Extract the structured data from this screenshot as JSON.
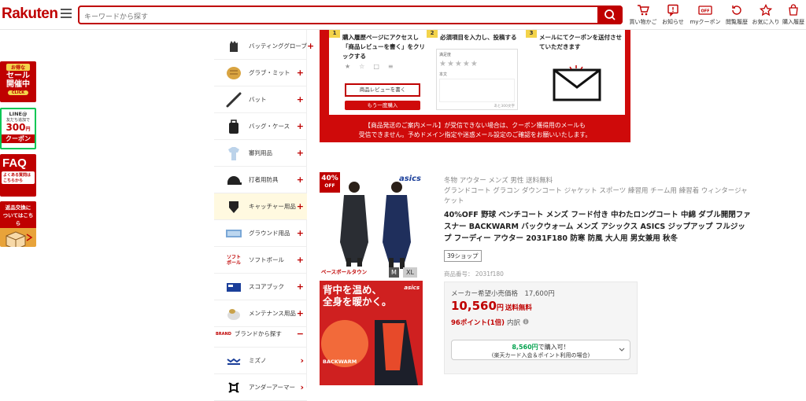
{
  "header": {
    "logo": "Rakuten",
    "search_placeholder": "キーワードから探す",
    "icons": [
      {
        "label": "買い物かご",
        "icon": "cart-icon"
      },
      {
        "label": "お知らせ",
        "icon": "notice-icon"
      },
      {
        "label": "myクーポン",
        "icon": "coupon-icon"
      },
      {
        "label": "閲覧履歴",
        "icon": "history-icon"
      },
      {
        "label": "お気に入り",
        "icon": "star-icon"
      },
      {
        "label": "購入履歴",
        "icon": "purchase-history-icon"
      }
    ]
  },
  "left_banners": {
    "sale": {
      "top": "お得な",
      "main1": "セール",
      "main2": "開催中",
      "cta": "CLICK"
    },
    "line": {
      "top": "LINE@",
      "sub": "友だち追加で",
      "amount": "300",
      "unit": "円",
      "main": "クーポン"
    },
    "faq": {
      "main": "FAQ",
      "sub": "よくある質問は",
      "sub2": "こちらから"
    },
    "exchange": {
      "l1": "返品交換に",
      "l2": "ついてはこちら"
    }
  },
  "sidebar": {
    "items": [
      {
        "label": "バッティンググローブ",
        "expand": "+"
      },
      {
        "label": "グラブ・ミット",
        "expand": "+"
      },
      {
        "label": "バット",
        "expand": "+"
      },
      {
        "label": "バッグ・ケース",
        "expand": "+"
      },
      {
        "label": "審判用品",
        "expand": "+"
      },
      {
        "label": "打者用防具",
        "expand": "+"
      },
      {
        "label": "キャッチャー用品",
        "expand": "+"
      },
      {
        "label": "グラウンド用品",
        "expand": "+"
      },
      {
        "label": "ソフトボール",
        "expand": "+"
      },
      {
        "label": "スコアブック",
        "expand": "+"
      },
      {
        "label": "メンテナンス用品",
        "expand": "+"
      },
      {
        "label": "ブランドから探す",
        "expand": "−"
      },
      {
        "label": "ミズノ",
        "expand": "›"
      },
      {
        "label": "アンダーアーマー",
        "expand": "›"
      }
    ],
    "brand_prefix": "BRAND",
    "softball_logo": "ソフト ボール"
  },
  "promo": {
    "step1": {
      "num": "1",
      "title": "購入履歴ページにアクセスし「商品レビューを書く」をクリックする",
      "button": "商品レビューを書く",
      "button2": "もう一度購入",
      "mini_labels": [
        "★",
        "☆",
        "□",
        "≡"
      ]
    },
    "step2": {
      "num": "2",
      "title": "必須項目を入力し、投稿する",
      "field1": "満足度",
      "field2": "本文",
      "required": "必須",
      "counter": "あと300文字"
    },
    "step3": {
      "num": "3",
      "title": "メールにてクーポンを送付させていただきます"
    },
    "footer_line1": "【商品発送のご案内メール】が受信できない場合は、クーポン獲得用のメールも",
    "footer_line2": "受信できません。予めドメイン指定や迷惑メール設定のご確認をお願いいたします。"
  },
  "product": {
    "discount_badge": "40%",
    "discount_badge_sub": "OFF",
    "brand_logo": "asics",
    "size_labels": [
      "M",
      "XL"
    ],
    "shop_logo": "ベースボールタウン",
    "img2_text1": "背中を温め、",
    "img2_text2": "全身を暖かく。",
    "img2_brand": "asics",
    "img2_caption": "BACKWARM",
    "tags_line1": "冬物 アウター メンズ 男性 送料無料",
    "tags_line2": "グランドコート グラコン ダウンコート ジャケット スポーツ 練習用 チーム用 練習着 ウィンタージャケット",
    "title": "40%OFF 野球 ベンチコート メンズ フード付き 中わたロングコート 中綿 ダブル開閉ファスナー BACKWARM バックウォーム メンズ アシックス ASICS ジップアップ フルジップ フーディー アウター 2031F180 防寒 防風 大人用 男女兼用 秋冬",
    "shop_badge": "39ショップ",
    "product_number": "商品番号： 2031f180",
    "list_price": "メーカー希望小売価格　17,600円",
    "price": "10,560",
    "price_unit": "円",
    "shipping": "送料無料",
    "points": "96ポイント(1倍)",
    "points_note": "内訳",
    "buy_line1_price": "8,560円",
    "buy_line1_suffix": "で購入可！",
    "buy_line2": "(楽天カード入会＆ポイント利用の場合)"
  },
  "colors": {
    "brand_red": "#bf0000",
    "promo_red": "#cf0a0a",
    "line_green": "#06c755",
    "yellow": "#f3d34a"
  }
}
